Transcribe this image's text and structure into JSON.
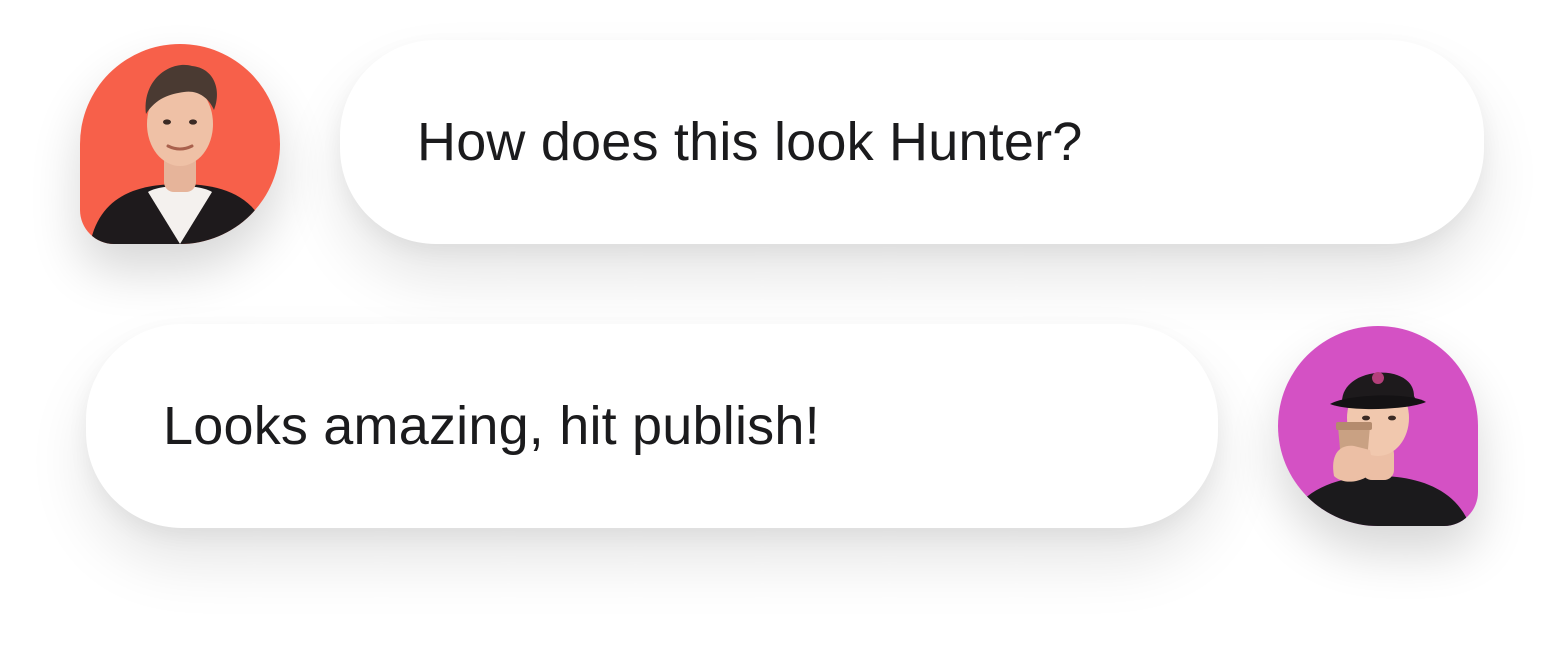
{
  "chat": {
    "messages": [
      {
        "text": "How does this look Hunter?",
        "avatar_icon": "person-avatar-icon",
        "avatar_bg": "#f7604a"
      },
      {
        "text": "Looks amazing, hit publish!",
        "avatar_icon": "person-avatar-icon",
        "avatar_bg": "#d451c4"
      }
    ]
  }
}
